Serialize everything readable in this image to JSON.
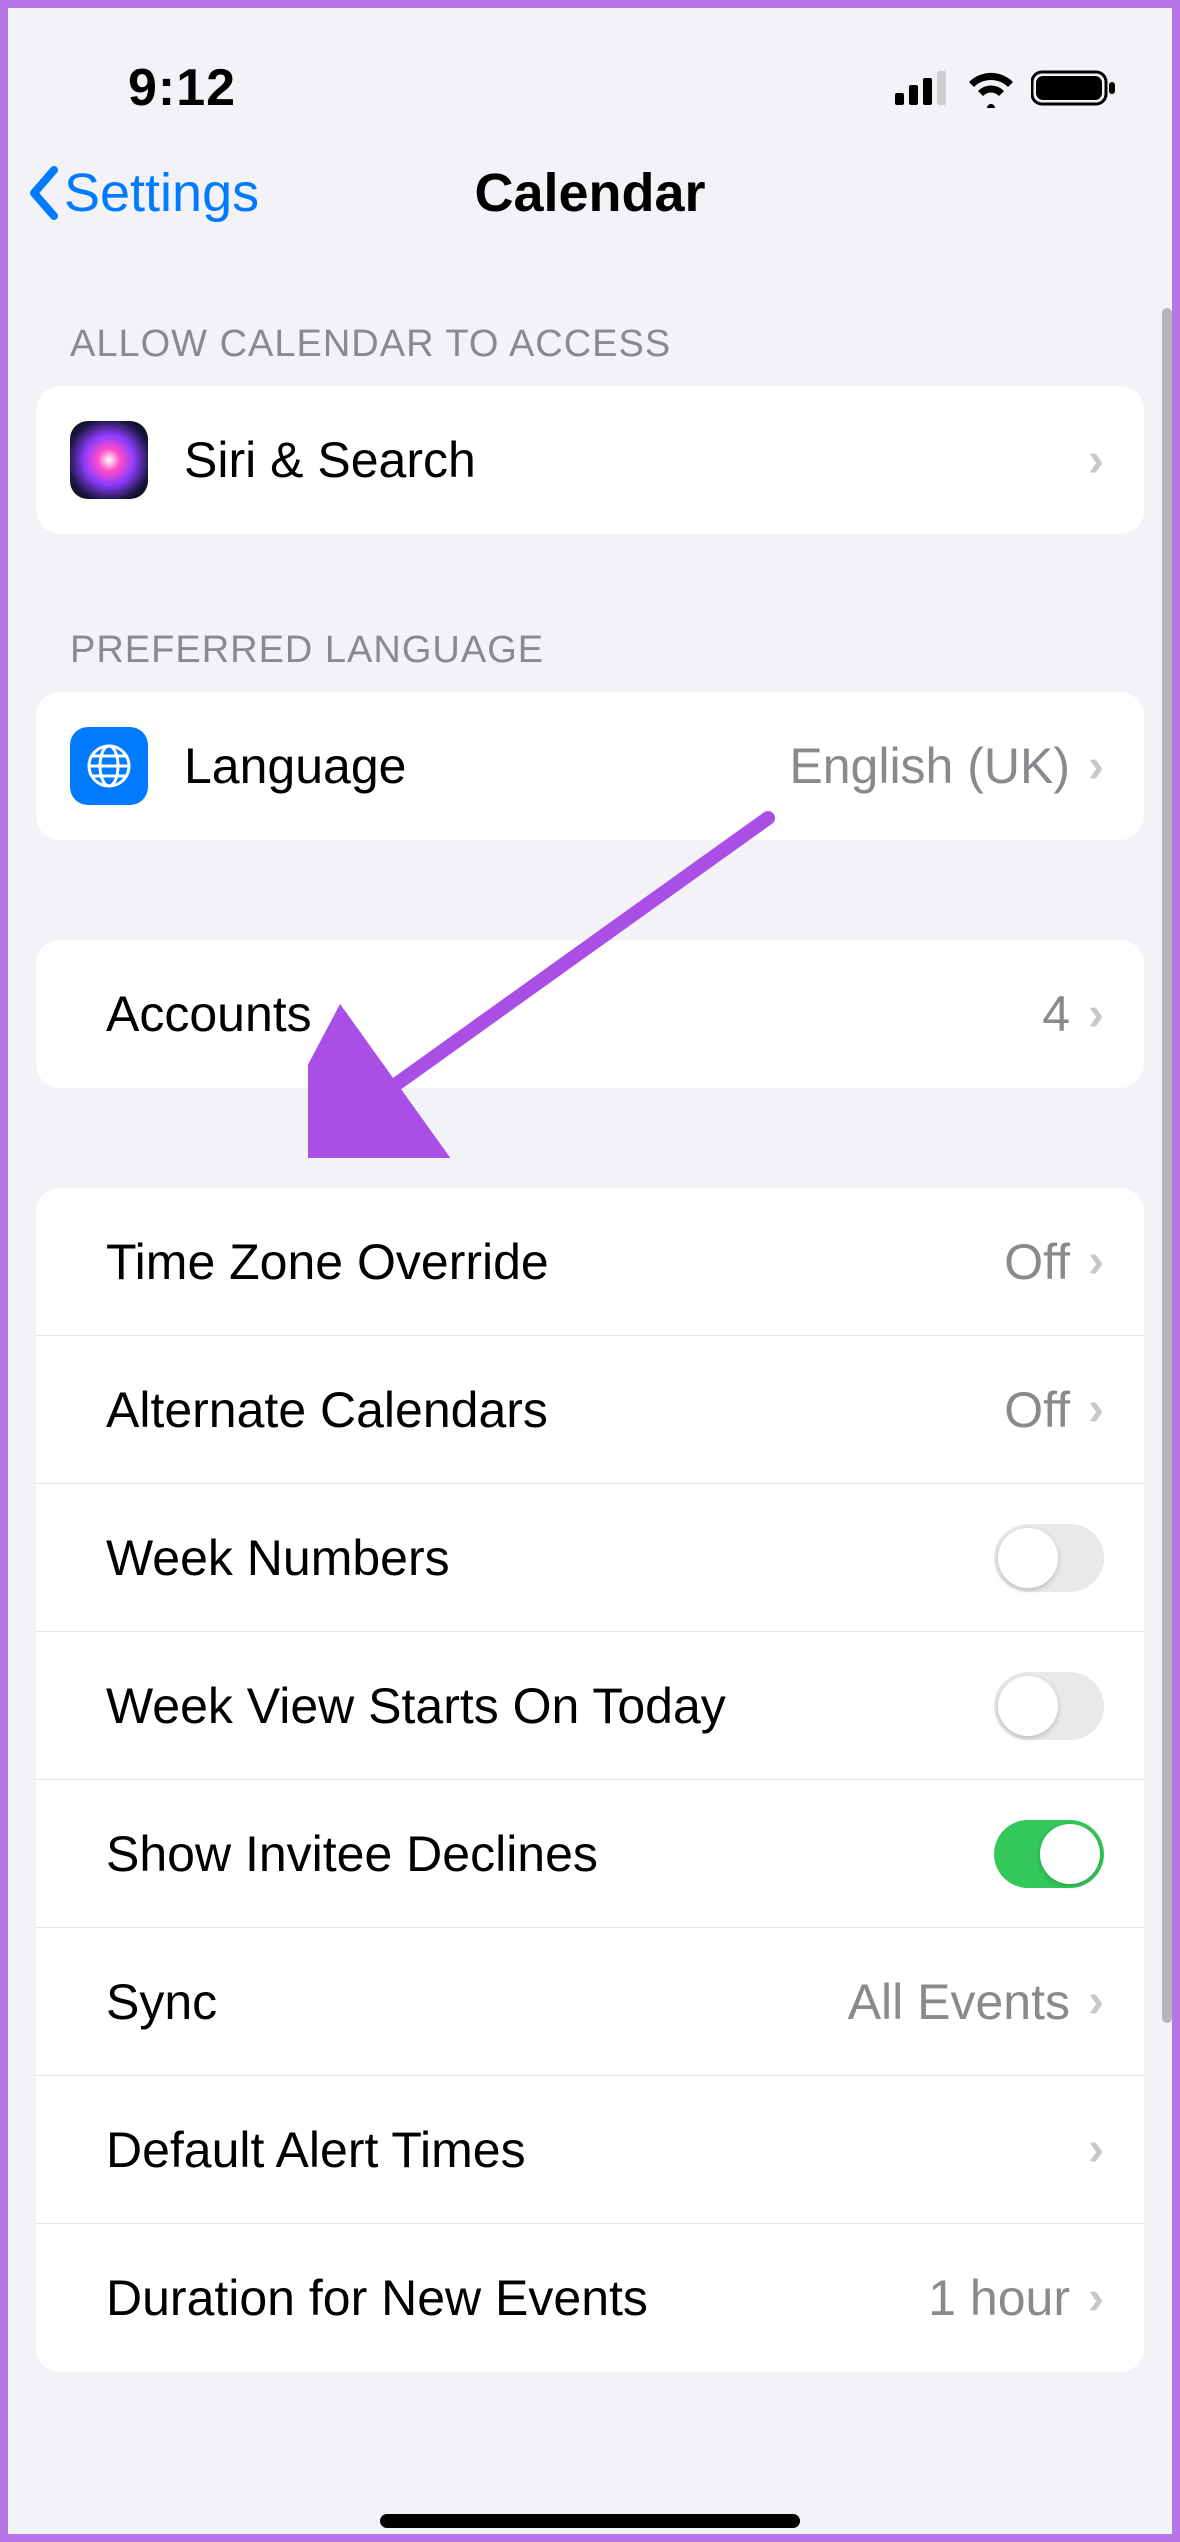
{
  "status": {
    "time": "9:12"
  },
  "nav": {
    "back_label": "Settings",
    "title": "Calendar"
  },
  "sections": {
    "access_header": "ALLOW CALENDAR TO ACCESS",
    "language_header": "PREFERRED LANGUAGE"
  },
  "rows": {
    "siri": {
      "label": "Siri & Search"
    },
    "language": {
      "label": "Language",
      "value": "English (UK)"
    },
    "accounts": {
      "label": "Accounts",
      "value": "4"
    },
    "timezone": {
      "label": "Time Zone Override",
      "value": "Off"
    },
    "altcal": {
      "label": "Alternate Calendars",
      "value": "Off"
    },
    "weeknum": {
      "label": "Week Numbers"
    },
    "weekview": {
      "label": "Week View Starts On Today"
    },
    "declines": {
      "label": "Show Invitee Declines"
    },
    "sync": {
      "label": "Sync",
      "value": "All Events"
    },
    "alert": {
      "label": "Default Alert Times"
    },
    "duration": {
      "label": "Duration for New Events",
      "value": "1 hour"
    }
  }
}
